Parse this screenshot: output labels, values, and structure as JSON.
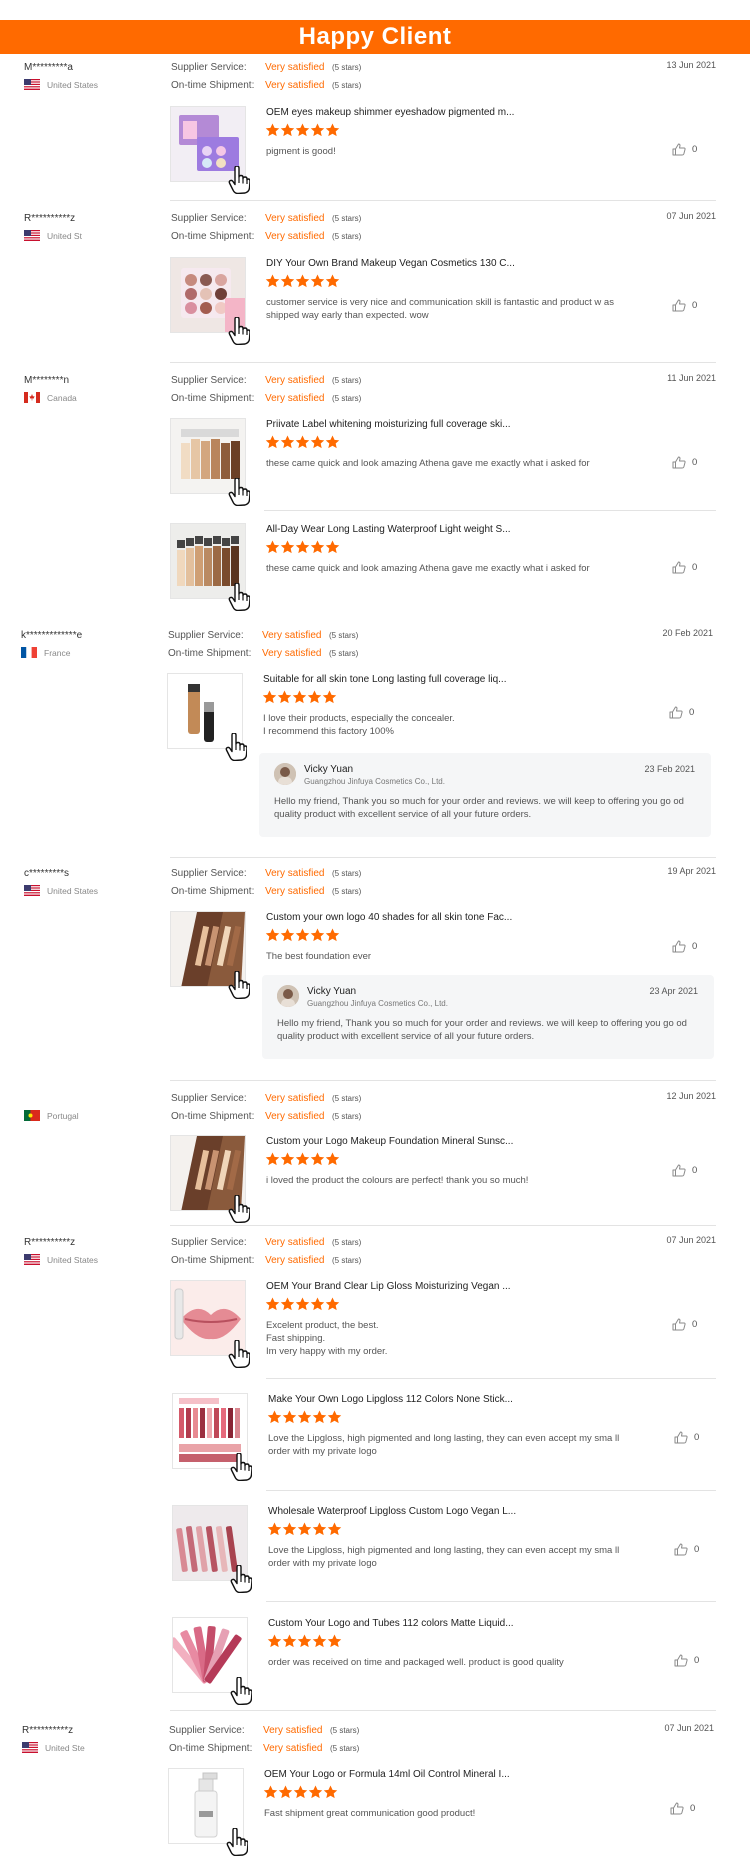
{
  "banner": {
    "title": "Happy Client"
  },
  "labels": {
    "supplier_service": "Supplier Service:",
    "on_time_shipment": "On-time Shipment:",
    "very_satisfied": "Very satisfied",
    "five_stars": "(5 stars)"
  },
  "reviews": [
    {
      "buyer": "M*********a",
      "country": "United States",
      "flag": "us",
      "date": "13 Jun 2021",
      "items": [
        {
          "title": "OEM eyes makeup shimmer eyeshadow pigmented m...",
          "text": "pigment is good!",
          "likes": "0",
          "thumb": "eyeshadow-palette"
        }
      ]
    },
    {
      "buyer": "R**********z",
      "country": "United St",
      "flag": "us",
      "date": "07 Jun 2021",
      "items": [
        {
          "title": "DIY Your Own Brand Makeup Vegan Cosmetics 130 C...",
          "text": "customer service is very nice and communication skill is fantastic and product w as shipped way early than expected. wow",
          "likes": "0",
          "thumb": "eyeshadow-grid"
        }
      ]
    },
    {
      "buyer": "M********n",
      "country": "Canada",
      "flag": "ca",
      "date": "11 Jun 2021",
      "items": [
        {
          "title": "Priivate Label whitening moisturizing full coverage ski...",
          "text": "these came quick and look amazing Athena gave me exactly what i asked for",
          "likes": "0",
          "thumb": "foundation-bottles"
        },
        {
          "title": "All-Day Wear Long Lasting Waterproof Light weight S...",
          "text": "these came quick and look amazing Athena gave me exactly what i asked for",
          "likes": "0",
          "thumb": "foundation-row"
        }
      ]
    },
    {
      "buyer": "k*************e",
      "country": "France",
      "flag": "fr",
      "date": "20 Feb 2021",
      "items": [
        {
          "title": "Suitable for all skin tone Long lasting full coverage liq...",
          "text": "I love their products, especially the concealer.\nI recommend this factory 100%",
          "likes": "0",
          "thumb": "concealer"
        }
      ],
      "reply": {
        "name": "Vicky Yuan",
        "company": "Guangzhou Jinfuya Cosmetics Co., Ltd.",
        "date": "23 Feb 2021",
        "text": "Hello my friend, Thank you so much for your order and reviews. we will keep to offering you go od quality product with excellent service of all your future orders."
      }
    },
    {
      "buyer": "c*********s",
      "country": "United States",
      "flag": "us",
      "date": "19 Apr 2021",
      "items": [
        {
          "title": "Custom your own logo 40 shades for all skin tone Fac...",
          "text": "The best foundation ever",
          "likes": "0",
          "thumb": "swatch-arm"
        }
      ],
      "reply": {
        "name": "Vicky Yuan",
        "company": "Guangzhou Jinfuya Cosmetics Co., Ltd.",
        "date": "23 Apr 2021",
        "text": "Hello my friend, Thank you so much for your order and reviews. we will keep to offering you go od quality product with excellent service of all your future orders."
      }
    },
    {
      "buyer": "",
      "country": "Portugal",
      "flag": "pt",
      "date": "12 Jun 2021",
      "items": [
        {
          "title": "Custom your Logo Makeup Foundation Mineral Sunsc...",
          "text": "i loved the product the colours are perfect! thank you so much!",
          "likes": "0",
          "thumb": "swatch-arm"
        }
      ]
    },
    {
      "buyer": "R**********z",
      "country": "United States",
      "flag": "us",
      "date": "07 Jun 2021",
      "items": [
        {
          "title": "OEM Your Brand Clear Lip Gloss Moisturizing Vegan ...",
          "text": "Excelent product, the best.\nFast shipping.\nIm very happy with my order.",
          "likes": "0",
          "thumb": "lips"
        },
        {
          "title": "Make Your Own Logo Lipgloss 112 Colors None Stick...",
          "text": "Love the Lipgloss, high pigmented and long lasting, they can even accept my sma ll order with my private logo",
          "likes": "0",
          "thumb": "lipgloss-chart"
        },
        {
          "title": "Wholesale Waterproof Lipgloss Custom Logo Vegan L...",
          "text": "Love the Lipgloss, high pigmented and long lasting, they can even accept my sma ll order with my private logo",
          "likes": "0",
          "thumb": "lipgloss-tubes"
        },
        {
          "title": "Custom Your Logo and Tubes 112 colors Matte Liquid...",
          "text": "order was received on time and packaged well. product is good quality",
          "likes": "0",
          "thumb": "lipgloss-fan"
        }
      ]
    },
    {
      "buyer": "R**********z",
      "country": "United Ste",
      "flag": "us",
      "date": "07 Jun 2021",
      "items": [
        {
          "title": "OEM Your Logo or Formula 14ml Oil Control Mineral I...",
          "text": "Fast shipment great communication good product!",
          "likes": "0",
          "thumb": "pump-bottle"
        }
      ]
    }
  ]
}
